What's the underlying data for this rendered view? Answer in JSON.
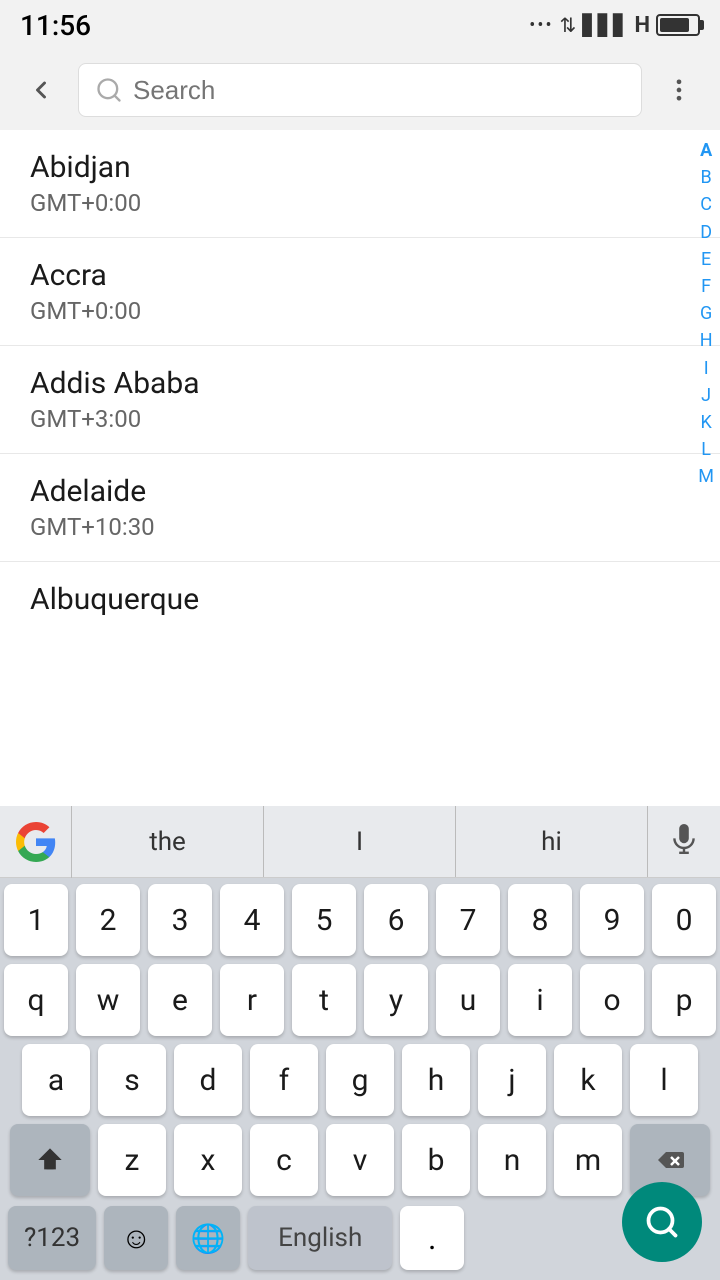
{
  "statusBar": {
    "time": "11:56"
  },
  "searchBar": {
    "placeholder": "Search",
    "backLabel": "back",
    "moreLabel": "more options"
  },
  "timezones": [
    {
      "city": "Abidjan",
      "gmt": "GMT+0:00"
    },
    {
      "city": "Accra",
      "gmt": "GMT+0:00"
    },
    {
      "city": "Addis Ababa",
      "gmt": "GMT+3:00"
    },
    {
      "city": "Adelaide",
      "gmt": "GMT+10:30"
    },
    {
      "city": "Albuquerque",
      "gmt": ""
    }
  ],
  "alphaIndex": [
    "A",
    "B",
    "C",
    "D",
    "E",
    "F",
    "G",
    "H",
    "I",
    "J",
    "K",
    "L",
    "M"
  ],
  "keyboard": {
    "suggestions": [
      "the",
      "I",
      "hi"
    ],
    "rows": [
      [
        "1",
        "2",
        "3",
        "4",
        "5",
        "6",
        "7",
        "8",
        "9",
        "0"
      ],
      [
        "q",
        "w",
        "e",
        "r",
        "t",
        "y",
        "u",
        "i",
        "o",
        "p"
      ],
      [
        "a",
        "s",
        "d",
        "f",
        "g",
        "h",
        "j",
        "k",
        "l"
      ],
      [
        "z",
        "x",
        "c",
        "v",
        "b",
        "n",
        "m"
      ]
    ],
    "bottomRow": {
      "numeric": "?123",
      "emoji": "☺",
      "globe": "🌐",
      "space": "English",
      "period": ".",
      "backspace": "⌫"
    }
  }
}
